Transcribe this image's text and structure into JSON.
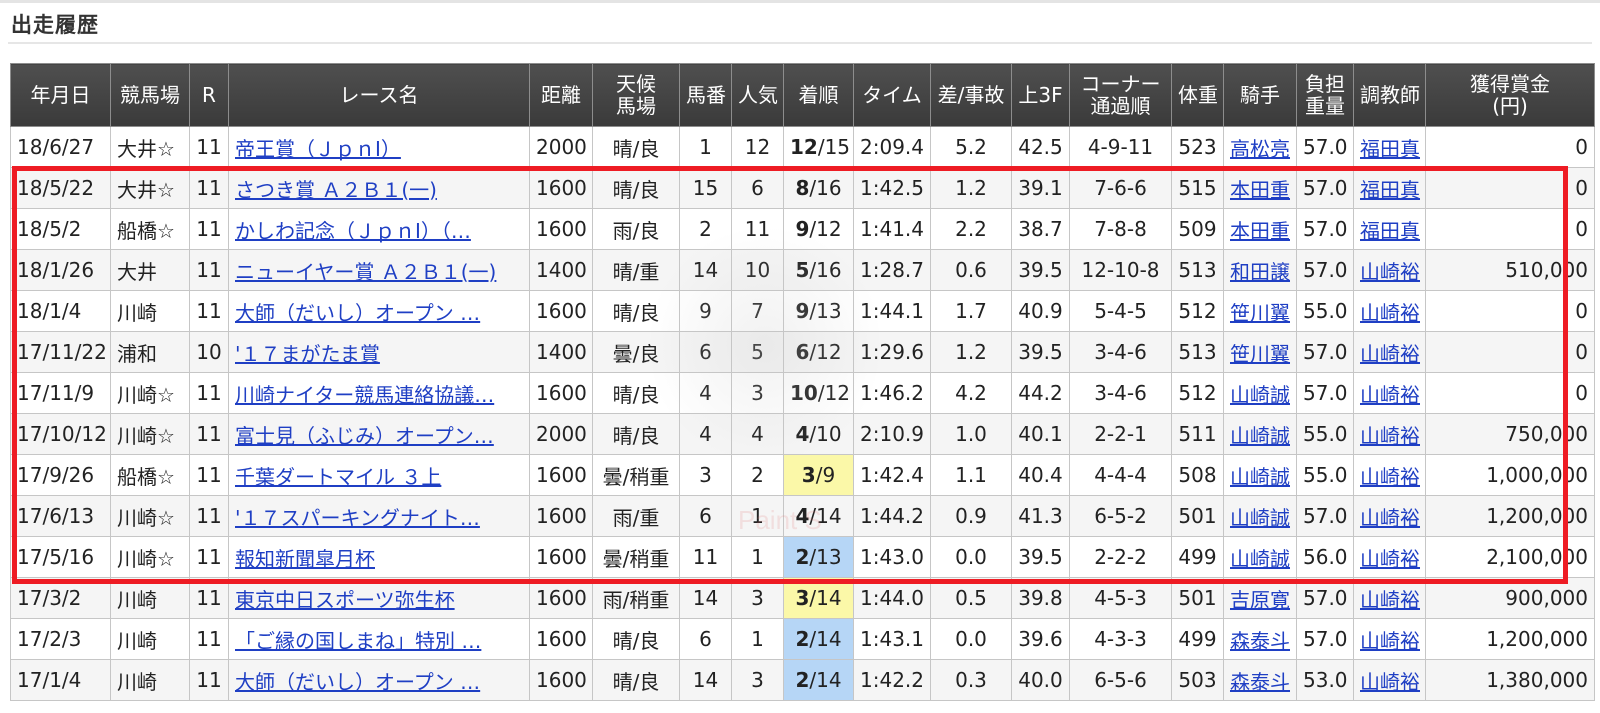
{
  "section": {
    "title": "出走履歴"
  },
  "watermark": {
    "text": "Paint S"
  },
  "table": {
    "headers": [
      {
        "line1": "年月日",
        "line2": ""
      },
      {
        "line1": "競馬場",
        "line2": ""
      },
      {
        "line1": "R",
        "line2": ""
      },
      {
        "line1": "レース名",
        "line2": ""
      },
      {
        "line1": "距離",
        "line2": ""
      },
      {
        "line1": "天候",
        "line2": "馬場"
      },
      {
        "line1": "馬番",
        "line2": ""
      },
      {
        "line1": "人気",
        "line2": ""
      },
      {
        "line1": "着順",
        "line2": ""
      },
      {
        "line1": "タイム",
        "line2": ""
      },
      {
        "line1": "差/事故",
        "line2": ""
      },
      {
        "line1": "上3F",
        "line2": ""
      },
      {
        "line1": "コーナー",
        "line2": "通過順"
      },
      {
        "line1": "体重",
        "line2": ""
      },
      {
        "line1": "騎手",
        "line2": ""
      },
      {
        "line1": "負担",
        "line2": "重量"
      },
      {
        "line1": "調教師",
        "line2": ""
      },
      {
        "line1": "獲得賞金",
        "line2": "(円)"
      }
    ],
    "rows": [
      {
        "date": "18/6/27",
        "track": "大井☆",
        "r": "11",
        "race": "帝王賞（ＪｐｎI）",
        "dist": "2000",
        "weather": "晴/良",
        "num": "1",
        "pop": "12",
        "pos": "12",
        "field": "/15",
        "finish_color": "",
        "time": "2:09.4",
        "diff": "5.2",
        "f3": "42.5",
        "corner": "4-9-11",
        "weight": "523",
        "jockey": "高松亮",
        "load": "57.0",
        "trainer": "福田真",
        "prize": "0"
      },
      {
        "date": "18/5/22",
        "track": "大井☆",
        "r": "11",
        "race": "さつき賞 Ａ２Ｂ１(一)",
        "dist": "1600",
        "weather": "晴/良",
        "num": "15",
        "pop": "6",
        "pos": "8",
        "field": "/16",
        "finish_color": "",
        "time": "1:42.5",
        "diff": "1.2",
        "f3": "39.1",
        "corner": "7-6-6",
        "weight": "515",
        "jockey": "本田重",
        "load": "57.0",
        "trainer": "福田真",
        "prize": "0"
      },
      {
        "date": "18/5/2",
        "track": "船橋☆",
        "r": "11",
        "race": "かしわ記念（ＪｐｎI）（…",
        "dist": "1600",
        "weather": "雨/良",
        "num": "2",
        "pop": "11",
        "pos": "9",
        "field": "/12",
        "finish_color": "",
        "time": "1:41.4",
        "diff": "2.2",
        "f3": "38.7",
        "corner": "7-8-8",
        "weight": "509",
        "jockey": "本田重",
        "load": "57.0",
        "trainer": "福田真",
        "prize": "0"
      },
      {
        "date": "18/1/26",
        "track": "大井",
        "r": "11",
        "race": "ニューイヤー賞 Ａ２Ｂ１(一)",
        "dist": "1400",
        "weather": "晴/重",
        "num": "14",
        "pop": "10",
        "pos": "5",
        "field": "/16",
        "finish_color": "",
        "time": "1:28.7",
        "diff": "0.6",
        "f3": "39.5",
        "corner": "12-10-8",
        "weight": "513",
        "jockey": "和田譲",
        "load": "57.0",
        "trainer": "山崎裕",
        "prize": "510,000"
      },
      {
        "date": "18/1/4",
        "track": "川崎",
        "r": "11",
        "race": "大師（だいし）オープン …",
        "dist": "1600",
        "weather": "晴/良",
        "num": "9",
        "pop": "7",
        "pos": "9",
        "field": "/13",
        "finish_color": "",
        "time": "1:44.1",
        "diff": "1.7",
        "f3": "40.9",
        "corner": "5-4-5",
        "weight": "512",
        "jockey": "笹川翼",
        "load": "55.0",
        "trainer": "山崎裕",
        "prize": "0"
      },
      {
        "date": "17/11/22",
        "track": "浦和",
        "r": "10",
        "race": "'１７まがたま賞",
        "dist": "1400",
        "weather": "曇/良",
        "num": "6",
        "pop": "5",
        "pos": "6",
        "field": "/12",
        "finish_color": "",
        "time": "1:29.6",
        "diff": "1.2",
        "f3": "39.5",
        "corner": "3-4-6",
        "weight": "513",
        "jockey": "笹川翼",
        "load": "57.0",
        "trainer": "山崎裕",
        "prize": "0"
      },
      {
        "date": "17/11/9",
        "track": "川崎☆",
        "r": "11",
        "race": "川崎ナイター競馬連絡協議…",
        "dist": "1600",
        "weather": "晴/良",
        "num": "4",
        "pop": "3",
        "pos": "10",
        "field": "/12",
        "finish_color": "",
        "time": "1:46.2",
        "diff": "4.2",
        "f3": "44.2",
        "corner": "3-4-6",
        "weight": "512",
        "jockey": "山崎誠",
        "load": "57.0",
        "trainer": "山崎裕",
        "prize": "0"
      },
      {
        "date": "17/10/12",
        "track": "川崎☆",
        "r": "11",
        "race": "富士見（ふじみ）オープン…",
        "dist": "2000",
        "weather": "晴/良",
        "num": "4",
        "pop": "4",
        "pos": "4",
        "field": "/10",
        "finish_color": "",
        "time": "2:10.9",
        "diff": "1.0",
        "f3": "40.1",
        "corner": "2-2-1",
        "weight": "511",
        "jockey": "山崎誠",
        "load": "55.0",
        "trainer": "山崎裕",
        "prize": "750,000"
      },
      {
        "date": "17/9/26",
        "track": "船橋☆",
        "r": "11",
        "race": "千葉ダートマイル ３上",
        "dist": "1600",
        "weather": "曇/稍重",
        "num": "3",
        "pop": "2",
        "pos": "3",
        "field": "/9",
        "finish_color": "yellow",
        "time": "1:42.4",
        "diff": "1.1",
        "f3": "40.4",
        "corner": "4-4-4",
        "weight": "508",
        "jockey": "山崎誠",
        "load": "55.0",
        "trainer": "山崎裕",
        "prize": "1,000,000"
      },
      {
        "date": "17/6/13",
        "track": "川崎☆",
        "r": "11",
        "race": "'１７スパーキングナイト…",
        "dist": "1600",
        "weather": "雨/重",
        "num": "6",
        "pop": "1",
        "pos": "4",
        "field": "/14",
        "finish_color": "",
        "time": "1:44.2",
        "diff": "0.9",
        "f3": "41.3",
        "corner": "6-5-2",
        "weight": "501",
        "jockey": "山崎誠",
        "load": "57.0",
        "trainer": "山崎裕",
        "prize": "1,200,000"
      },
      {
        "date": "17/5/16",
        "track": "川崎☆",
        "r": "11",
        "race": "報知新聞皐月杯",
        "dist": "1600",
        "weather": "曇/稍重",
        "num": "11",
        "pop": "1",
        "pos": "2",
        "field": "/13",
        "finish_color": "blue",
        "time": "1:43.0",
        "diff": "0.0",
        "f3": "39.5",
        "corner": "2-2-2",
        "weight": "499",
        "jockey": "山崎誠",
        "load": "56.0",
        "trainer": "山崎裕",
        "prize": "2,100,000"
      },
      {
        "date": "17/3/2",
        "track": "川崎",
        "r": "11",
        "race": "東京中日スポーツ弥生杯",
        "dist": "1600",
        "weather": "雨/稍重",
        "num": "14",
        "pop": "3",
        "pos": "3",
        "field": "/14",
        "finish_color": "yellow",
        "time": "1:44.0",
        "diff": "0.5",
        "f3": "39.8",
        "corner": "4-5-3",
        "weight": "501",
        "jockey": "吉原寛",
        "load": "57.0",
        "trainer": "山崎裕",
        "prize": "900,000"
      },
      {
        "date": "17/2/3",
        "track": "川崎",
        "r": "11",
        "race": "「ご縁の国しまね」特別 …",
        "dist": "1600",
        "weather": "晴/良",
        "num": "6",
        "pop": "1",
        "pos": "2",
        "field": "/14",
        "finish_color": "blue",
        "time": "1:43.1",
        "diff": "0.0",
        "f3": "39.6",
        "corner": "4-3-3",
        "weight": "499",
        "jockey": "森泰斗",
        "load": "57.0",
        "trainer": "山崎裕",
        "prize": "1,200,000"
      },
      {
        "date": "17/1/4",
        "track": "川崎",
        "r": "11",
        "race": "大師（だいし）オープン …",
        "dist": "1600",
        "weather": "晴/良",
        "num": "14",
        "pop": "3",
        "pos": "2",
        "field": "/14",
        "finish_color": "blue",
        "time": "1:42.2",
        "diff": "0.3",
        "f3": "40.0",
        "corner": "6-5-6",
        "weight": "503",
        "jockey": "森泰斗",
        "load": "53.0",
        "trainer": "山崎裕",
        "prize": "1,380,000"
      }
    ]
  },
  "highlight": {
    "color": "#ee1c24"
  }
}
